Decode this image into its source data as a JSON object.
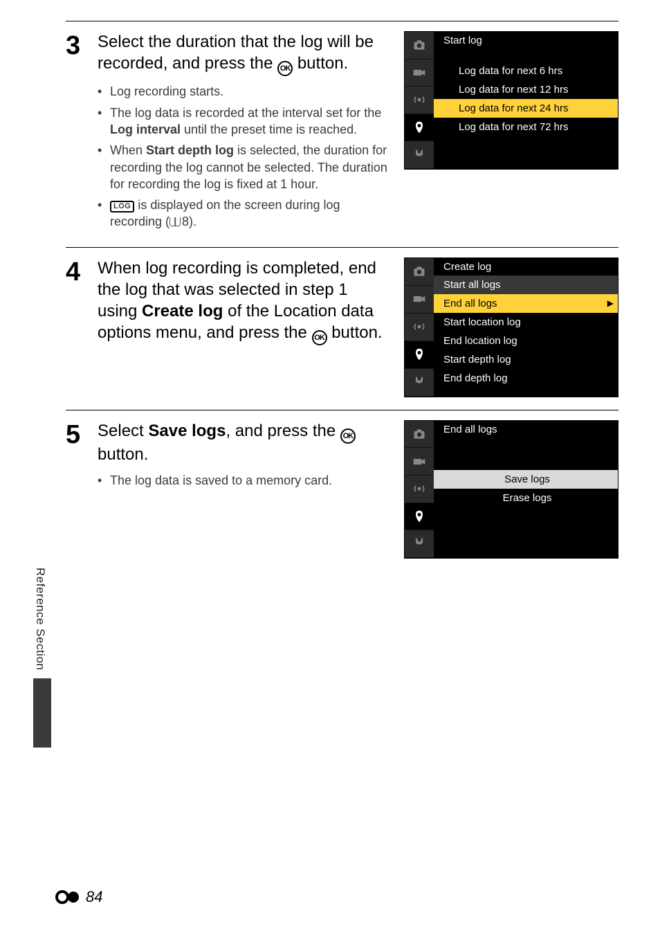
{
  "sideTab": "Reference Section",
  "footerPage": "84",
  "icons": {
    "ok": "OK",
    "log": "LOG"
  },
  "steps": [
    {
      "num": "3",
      "heading_parts": [
        "Select the duration that the log will be recorded, and press the ",
        "@OK",
        " button."
      ],
      "bullets": [
        {
          "text": "Log recording starts."
        },
        {
          "parts": [
            "The log data is recorded at the interval set for the ",
            {
              "b": "Log interval"
            },
            " until the preset time is reached."
          ]
        },
        {
          "parts": [
            "When ",
            {
              "b": "Start depth log"
            },
            " is selected, the duration for recording the log cannot be selected. The duration for recording the log is fixed at 1 hour."
          ]
        },
        {
          "parts": [
            {
              "log": true
            },
            " is displayed on the screen during log recording (",
            {
              "book": true
            },
            "8)."
          ]
        }
      ],
      "menu": {
        "title": "Start log",
        "type": "indent",
        "items": [
          {
            "label": "Log data for next 6 hrs"
          },
          {
            "label": "Log data for next 12 hrs"
          },
          {
            "label": "Log data for next 24 hrs",
            "selected": true
          },
          {
            "label": "Log data for next 72 hrs"
          }
        ]
      }
    },
    {
      "num": "4",
      "heading_parts": [
        "When log recording is completed, end the log that was selected in step 1 using ",
        {
          "b": "Create log"
        },
        " of the Location data options menu, and press the ",
        "@OK",
        " button."
      ],
      "menu": {
        "title": "Create log",
        "sub": "Start all logs",
        "type": "list",
        "items": [
          {
            "label": "End all logs",
            "selected": true,
            "arrow": true
          },
          {
            "label": "Start location log"
          },
          {
            "label": "End location log"
          },
          {
            "label": "Start depth log"
          },
          {
            "label": "End depth log"
          }
        ]
      }
    },
    {
      "num": "5",
      "heading_parts": [
        "Select ",
        {
          "b": "Save logs"
        },
        ", and press the ",
        "@OK",
        " button."
      ],
      "bullets": [
        {
          "text": "The log data is saved to a memory card."
        }
      ],
      "menu": {
        "title": "End all logs",
        "type": "center",
        "items": [
          {
            "label": "Save logs",
            "selected": true
          },
          {
            "label": "Erase logs"
          }
        ]
      }
    }
  ]
}
